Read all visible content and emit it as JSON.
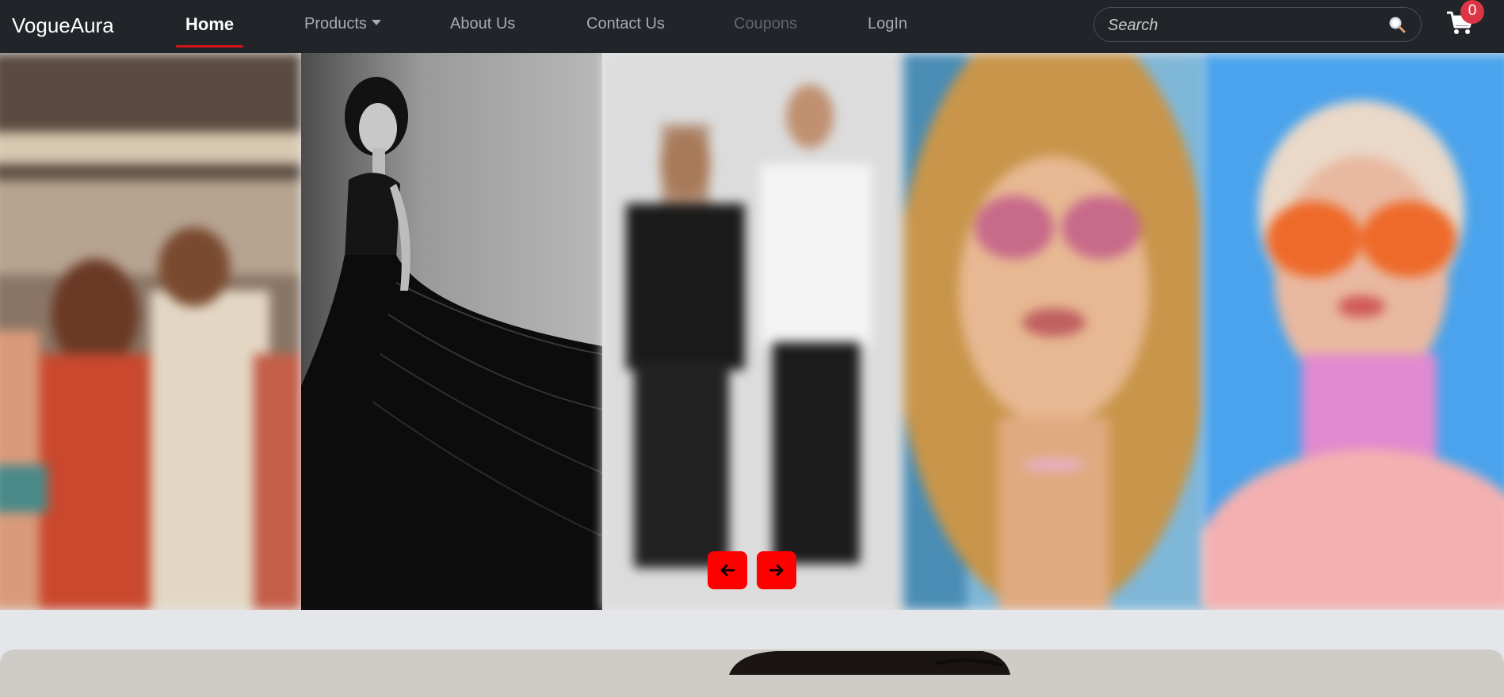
{
  "brand": "VogueAura",
  "nav": {
    "home": "Home",
    "products": "Products",
    "about": "About Us",
    "contact": "Contact Us",
    "coupons": "Coupons",
    "login": "LogIn"
  },
  "search": {
    "placeholder": "Search",
    "value": ""
  },
  "cart": {
    "count": "0",
    "icon": "cart-icon"
  },
  "colors": {
    "navbar_bg": "#212529",
    "active_underline": "#d0141a",
    "arrow_button": "#ff0000",
    "cart_badge": "#dc3545",
    "page_bg": "#e5e6ea"
  },
  "carousel": {
    "slides": [
      "street-group-photo",
      "model-black-gown",
      "couple-monochrome-outfits",
      "woman-pink-sunglasses",
      "woman-orange-heart-sunglasses"
    ],
    "prev_icon": "arrow-left-icon",
    "next_icon": "arrow-right-icon"
  }
}
